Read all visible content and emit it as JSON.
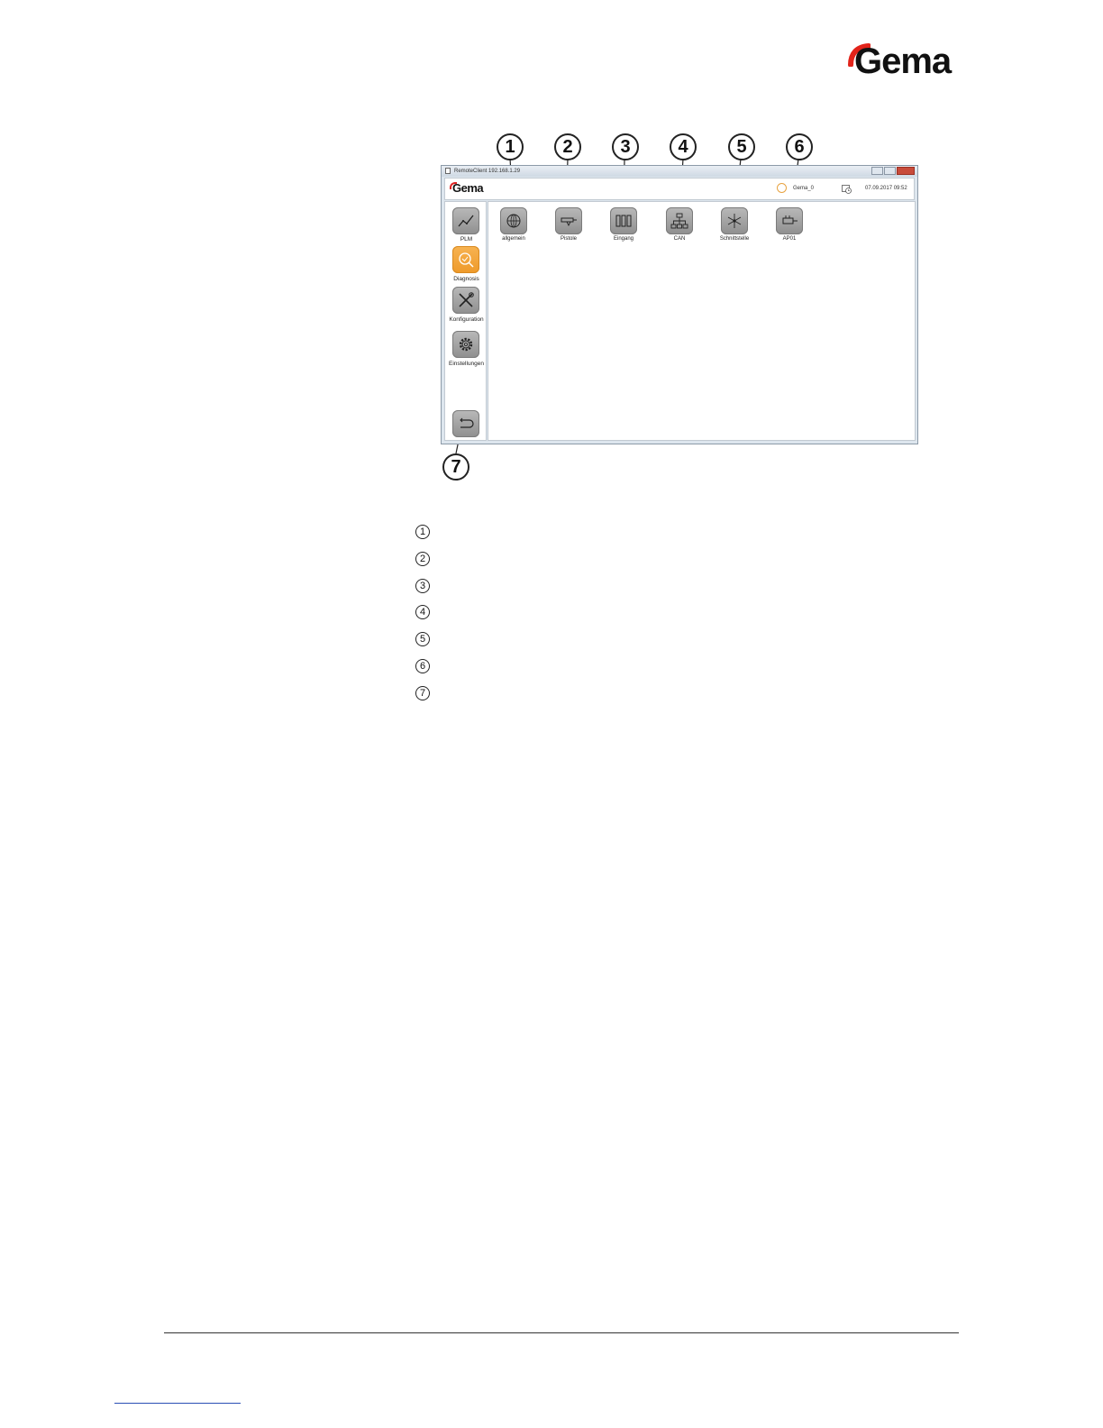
{
  "brand": {
    "logo_text": "Gema",
    "accent_color": "#e2231a"
  },
  "window": {
    "title": "RemoteClient 192.168.1.29",
    "header": {
      "logo": "Gema",
      "user": "Gema_0",
      "datetime": "07.09.2017 09:52"
    },
    "sidebar": {
      "items": [
        {
          "label": "PLM",
          "icon": "trend-chart-icon",
          "active": false
        },
        {
          "label": "Diagnosis",
          "icon": "magnifier-check-icon",
          "active": true
        },
        {
          "label": "Konfiguration",
          "icon": "tools-icon",
          "active": false
        },
        {
          "label": "Einstellungen",
          "icon": "gear-icon",
          "active": false
        }
      ],
      "back_icon": "return-arrow-icon"
    },
    "tiles": [
      {
        "label": "allgemein",
        "icon": "globe-icon"
      },
      {
        "label": "Pistole",
        "icon": "spray-gun-icon"
      },
      {
        "label": "Eingang",
        "icon": "input-modules-icon"
      },
      {
        "label": "CAN",
        "icon": "network-tree-icon"
      },
      {
        "label": "Schnittstelle",
        "icon": "interface-star-icon"
      },
      {
        "label": "AP01",
        "icon": "pump-icon"
      }
    ],
    "accent_color": "#f2a33a"
  },
  "callouts": [
    "1",
    "2",
    "3",
    "4",
    "5",
    "6",
    "7"
  ],
  "legend": [
    "1",
    "2",
    "3",
    "4",
    "5",
    "6",
    "7"
  ]
}
